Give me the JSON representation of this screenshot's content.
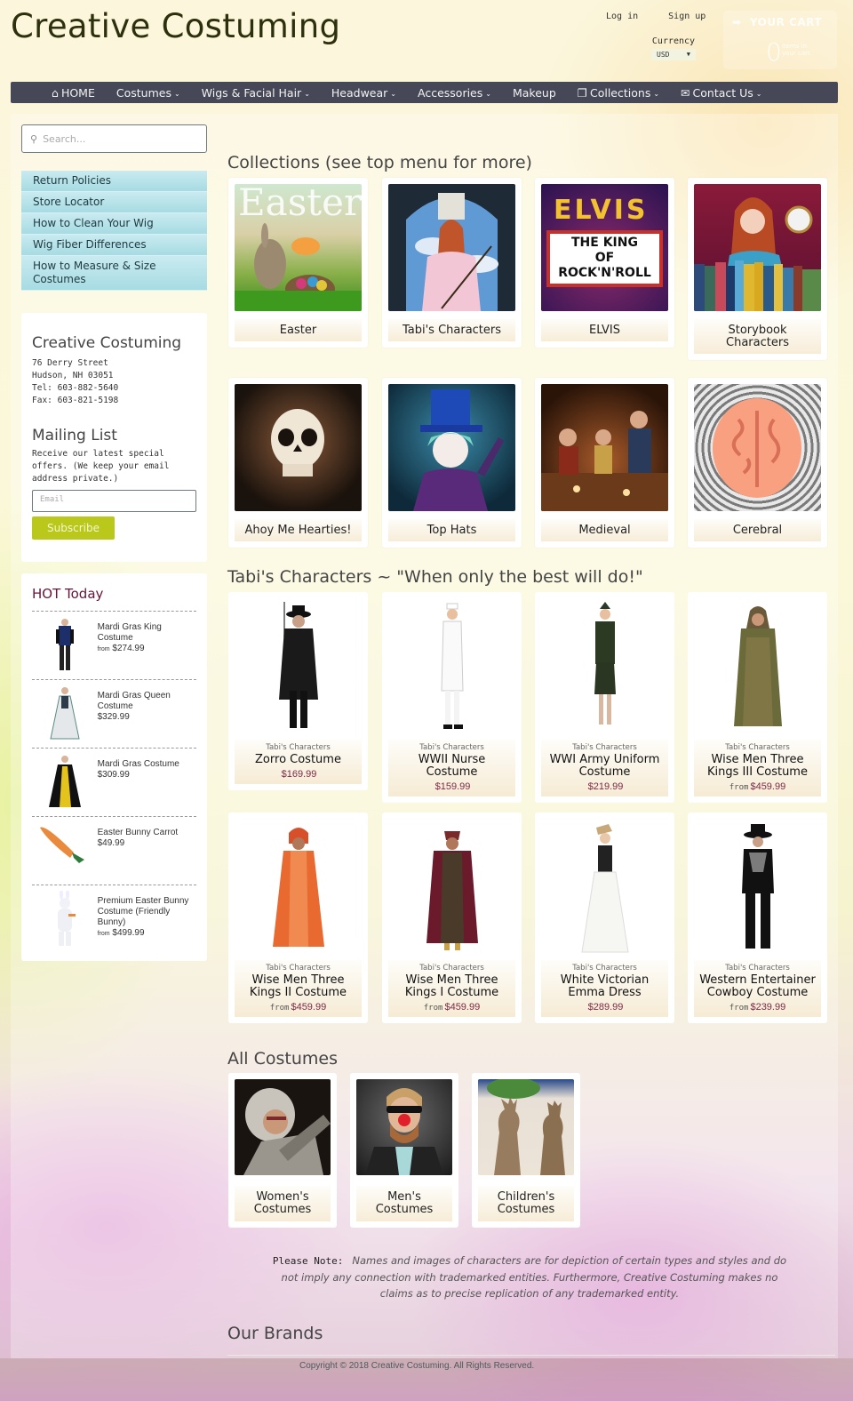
{
  "header": {
    "site_title": "Creative Costuming",
    "login": "Log in",
    "signup": "Sign up",
    "currency_label": "Currency",
    "currency_value": "USD",
    "cart_title": "YOUR CART",
    "cart_count": "0",
    "cart_subtext_1": "items in",
    "cart_subtext_2": "your cart"
  },
  "nav": [
    {
      "label": "HOME",
      "icon": "home-icon",
      "dropdown": false
    },
    {
      "label": "Costumes",
      "icon": null,
      "dropdown": true
    },
    {
      "label": "Wigs & Facial Hair",
      "icon": null,
      "dropdown": true
    },
    {
      "label": "Headwear",
      "icon": null,
      "dropdown": true
    },
    {
      "label": "Accessories",
      "icon": null,
      "dropdown": true
    },
    {
      "label": "Makeup",
      "icon": null,
      "dropdown": false
    },
    {
      "label": "Collections",
      "icon": "collections-icon",
      "dropdown": true
    },
    {
      "label": "Contact Us",
      "icon": "envelope-icon",
      "dropdown": true
    }
  ],
  "sidebar": {
    "search_placeholder": "Search...",
    "menu": [
      "Return Policies",
      "Store Locator",
      "How to Clean Your Wig",
      "Wig Fiber Differences",
      "How to Measure & Size Costumes"
    ],
    "contact": {
      "title": "Creative Costuming",
      "address1": "76 Derry Street",
      "address2": "Hudson, NH 03051",
      "tel": "Tel: 603-882-5640",
      "fax": "Fax: 603-821-5198"
    },
    "mailing": {
      "title": "Mailing List",
      "text": "Receive our latest special offers. (We keep your email address private.)",
      "email_placeholder": "Email",
      "subscribe_label": "Subscribe"
    },
    "hot": {
      "title": "HOT Today",
      "items": [
        {
          "name": "Mardi Gras King Costume",
          "from": "from",
          "price": "$274.99"
        },
        {
          "name": "Mardi Gras Queen Costume",
          "from": "",
          "price": "$329.99"
        },
        {
          "name": "Mardi Gras Costume",
          "from": "",
          "price": "$309.99"
        },
        {
          "name": "Easter Bunny Carrot",
          "from": "",
          "price": "$49.99"
        },
        {
          "name": "Premium Easter Bunny Costume (Friendly Bunny)",
          "from": "from",
          "price": "$499.99"
        }
      ]
    }
  },
  "collections": {
    "title": "Collections (see top menu for more)",
    "items": [
      {
        "label": "Easter",
        "image_text": "Easter"
      },
      {
        "label": "Tabi's Characters",
        "image_text": ""
      },
      {
        "label": "ELVIS",
        "image_text": "ELVIS",
        "image_sign": [
          "THE KING",
          "OF",
          "ROCK'N'ROLL"
        ]
      },
      {
        "label": "Storybook Characters",
        "image_text": ""
      },
      {
        "label": "Ahoy Me Hearties!",
        "image_text": ""
      },
      {
        "label": "Top Hats",
        "image_text": ""
      },
      {
        "label": "Medieval",
        "image_text": ""
      },
      {
        "label": "Cerebral",
        "image_text": ""
      }
    ]
  },
  "tabis": {
    "title": "Tabi's Characters ~ \"When only the best will do!\"",
    "products": [
      {
        "vendor": "Tabi's Characters",
        "title": "Zorro Costume",
        "from": "",
        "price": "$169.99"
      },
      {
        "vendor": "Tabi's Characters",
        "title": "WWII Nurse Costume",
        "from": "",
        "price": "$159.99"
      },
      {
        "vendor": "Tabi's Characters",
        "title": "WWI Army Uniform Costume",
        "from": "",
        "price": "$219.99"
      },
      {
        "vendor": "Tabi's Characters",
        "title": "Wise Men Three Kings III Costume",
        "from": "from",
        "price": "$459.99"
      },
      {
        "vendor": "Tabi's Characters",
        "title": "Wise Men Three Kings II Costume",
        "from": "from",
        "price": "$459.99"
      },
      {
        "vendor": "Tabi's Characters",
        "title": "Wise Men Three Kings I Costume",
        "from": "from",
        "price": "$459.99"
      },
      {
        "vendor": "Tabi's Characters",
        "title": "White Victorian Emma Dress",
        "from": "",
        "price": "$289.99"
      },
      {
        "vendor": "Tabi's Characters",
        "title": "Western Entertainer Cowboy Costume",
        "from": "from",
        "price": "$239.99"
      }
    ]
  },
  "all_costumes": {
    "title": "All Costumes",
    "items": [
      "Women's Costumes",
      "Men's Costumes",
      "Children's Costumes"
    ]
  },
  "note": {
    "label": "Please Note:",
    "text": "Names and images of characters are for depiction of certain types and styles and do not imply any connection with trademarked entities. Furthermore, Creative Costuming makes no claims as to precise replication of any trademarked entity."
  },
  "brands_title": "Our Brands",
  "footer": {
    "copyright": "Copyright © 2018 Creative Costuming. All Rights Reserved."
  },
  "colors": {
    "nav_bg": "#464857",
    "sidebar_menu": "#a7dbe3",
    "subscribe": "#b9c81a",
    "hot_title": "#6a1338",
    "price": "#7c2a47"
  }
}
